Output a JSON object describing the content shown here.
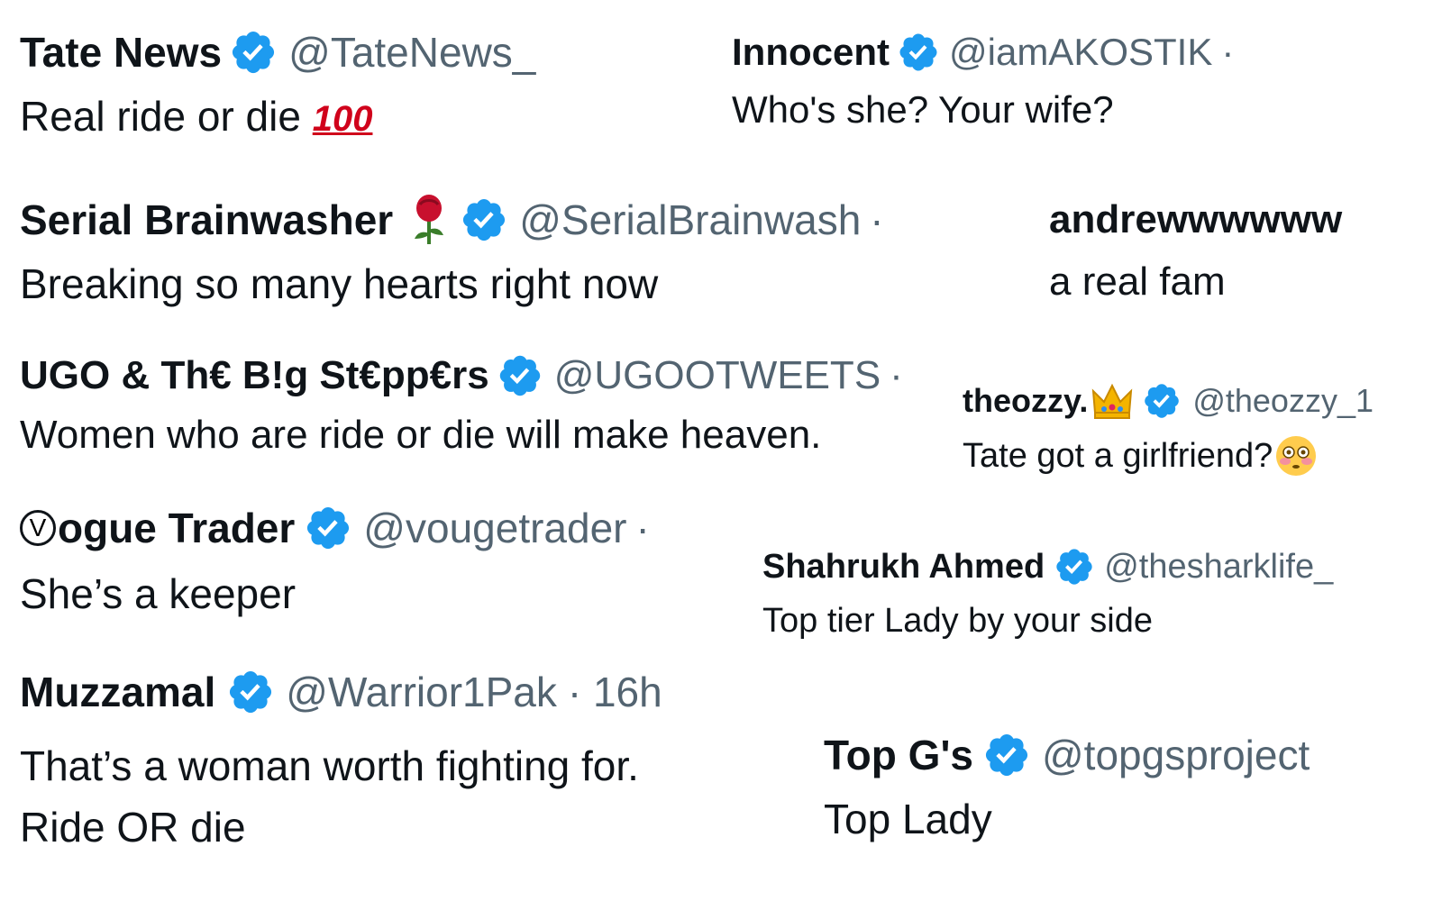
{
  "accent_color": "#1d9bf0",
  "verified_icon": "verified-badge-icon",
  "tweets": [
    {
      "name": "Tate News",
      "handle": "@TateNews_",
      "meta": "",
      "text": "Real ride or die",
      "emoji": "100"
    },
    {
      "name": "Innocent",
      "handle": "@iamAKOSTIK",
      "meta": "·",
      "text": "Who's she? Your wife?"
    },
    {
      "name": "Serial Brainwasher",
      "handle": "@SerialBrainwash",
      "meta": "·",
      "text": "Breaking so many hearts right now",
      "name_icon": "rose-icon"
    },
    {
      "name": "andrewwwwww",
      "handle": "",
      "meta": "",
      "text": "a real fam"
    },
    {
      "name": "UGO & Th€ B!g St€pp€rs",
      "handle": "@UGOOTWEETS",
      "meta": "·",
      "text": "Women who are ride or die will make heaven."
    },
    {
      "name": "theozzy.",
      "handle": "@theozzy_1",
      "meta": "",
      "text": "Tate got a girlfriend?",
      "name_icon": "crown-icon",
      "text_icon": "flushed-face-icon"
    },
    {
      "name_prefix": "V",
      "name": "ogue Trader",
      "handle": "@vougetrader",
      "meta": "·",
      "text": "She’s a keeper"
    },
    {
      "name": "Shahrukh Ahmed",
      "handle": "@thesharklife_",
      "meta": "",
      "text": "Top tier Lady by your side"
    },
    {
      "name": "Muzzamal",
      "handle": "@Warrior1Pak",
      "meta": "· 16h",
      "text_line1": "That’s a woman worth fighting for.",
      "text_line2": "Ride OR die"
    },
    {
      "name": "Top G's",
      "handle": "@topgsproject",
      "meta": "",
      "text": "Top Lady"
    }
  ]
}
